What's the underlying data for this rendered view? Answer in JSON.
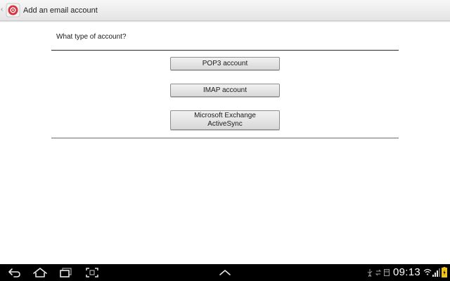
{
  "action_bar": {
    "title": "Add an email account",
    "icon": "email-app-icon"
  },
  "content": {
    "question": "What type of account?",
    "options": [
      {
        "label": "POP3 account"
      },
      {
        "label": "IMAP account"
      },
      {
        "label_line1": "Microsoft Exchange",
        "label_line2": "ActiveSync"
      }
    ]
  },
  "system_bar": {
    "buttons": [
      "back-icon",
      "home-icon",
      "recent-apps-icon",
      "screenshot-icon",
      "menu-up-icon"
    ],
    "status_icons": [
      "usb-icon",
      "sync-icon",
      "storage-icon",
      "wifi-icon",
      "signal-icon",
      "battery-icon"
    ],
    "time": "09:13"
  },
  "colors": {
    "app_icon_red": "#d9333f",
    "battery_yellow": "#f2c31b"
  }
}
